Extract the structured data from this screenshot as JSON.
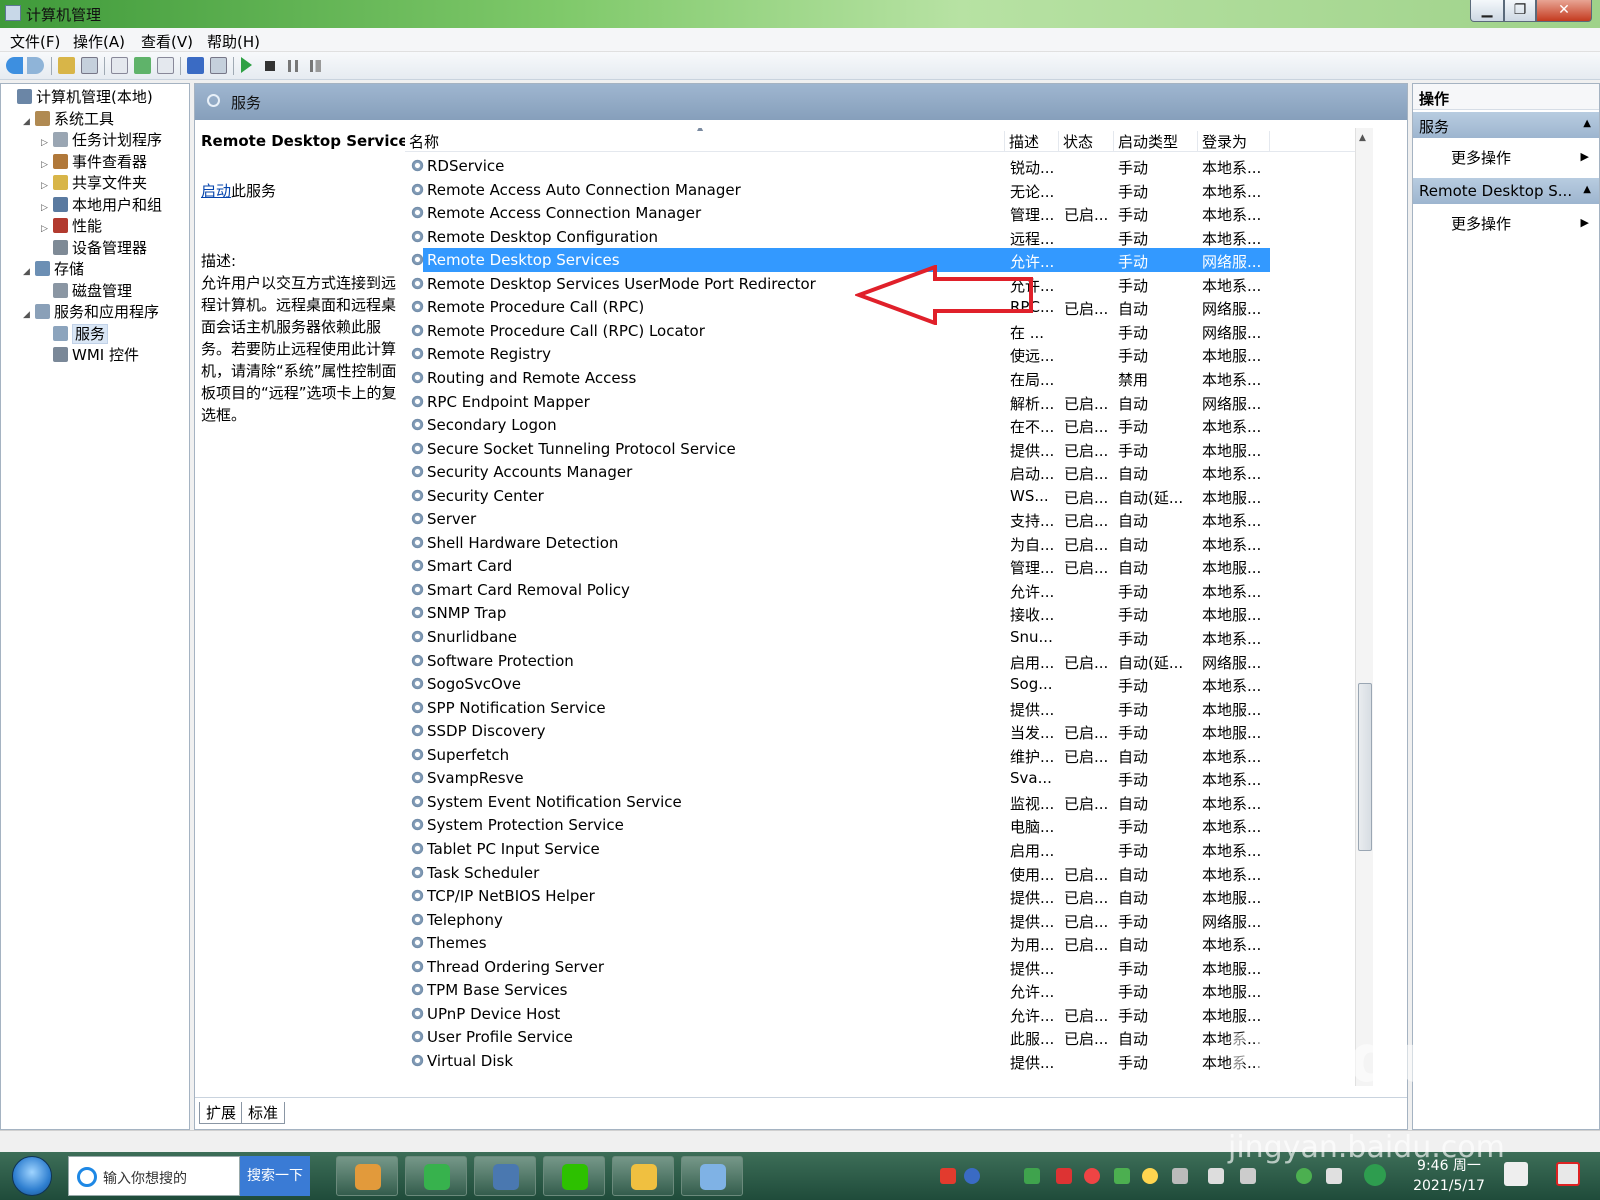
{
  "window": {
    "title": "计算机管理",
    "min_glyph": "▁",
    "max_glyph": "❐",
    "close_glyph": "✕"
  },
  "menu": [
    "文件(F)",
    "操作(A)",
    "查看(V)",
    "帮助(H)"
  ],
  "tree": [
    {
      "label": "计算机管理(本地)",
      "level": 0,
      "expander": "",
      "icon": "computer-management-icon",
      "color": "#6b86a6"
    },
    {
      "label": "系统工具",
      "level": 1,
      "expander": "◢",
      "icon": "tools-icon",
      "color": "#b08a52"
    },
    {
      "label": "任务计划程序",
      "level": 2,
      "expander": "▷",
      "icon": "clock-icon",
      "color": "#9aa6b3"
    },
    {
      "label": "事件查看器",
      "level": 2,
      "expander": "▷",
      "icon": "event-viewer-icon",
      "color": "#b0783a"
    },
    {
      "label": "共享文件夹",
      "level": 2,
      "expander": "▷",
      "icon": "shared-folder-icon",
      "color": "#d8b548"
    },
    {
      "label": "本地用户和组",
      "level": 2,
      "expander": "▷",
      "icon": "users-icon",
      "color": "#5a7aa0"
    },
    {
      "label": "性能",
      "level": 2,
      "expander": "▷",
      "icon": "performance-icon",
      "color": "#b23a2f"
    },
    {
      "label": "设备管理器",
      "level": 2,
      "expander": "",
      "icon": "device-manager-icon",
      "color": "#7e8a96"
    },
    {
      "label": "存储",
      "level": 1,
      "expander": "◢",
      "icon": "storage-icon",
      "color": "#6c8fb4"
    },
    {
      "label": "磁盘管理",
      "level": 2,
      "expander": "",
      "icon": "disk-icon",
      "color": "#8a96a3"
    },
    {
      "label": "服务和应用程序",
      "level": 1,
      "expander": "◢",
      "icon": "services-apps-icon",
      "color": "#8aa0b8"
    },
    {
      "label": "服务",
      "level": 2,
      "expander": "",
      "icon": "gear-icon",
      "color": "#8ca4bd",
      "selected": true
    },
    {
      "label": "WMI 控件",
      "level": 2,
      "expander": "",
      "icon": "wmi-icon",
      "color": "#7a8898"
    }
  ],
  "center": {
    "header": "服务",
    "detail": {
      "service_name": "Remote Desktop Services",
      "start_link": "启动",
      "start_suffix": "此服务",
      "desc_label": "描述:",
      "description": "允许用户以交互方式连接到远程计算机。远程桌面和远程桌面会话主机服务器依赖此服务。若要防止远程使用此计算机，请清除“系统”属性控制面板项目的“远程”选项卡上的复选框。"
    },
    "sort_glyph": "▲",
    "columns": [
      "名称",
      "描述",
      "状态",
      "启动类型",
      "登录为"
    ],
    "rows": [
      [
        "RDService",
        "锐动...",
        "",
        "手动",
        "本地系..."
      ],
      [
        "Remote Access Auto Connection Manager",
        "无论...",
        "",
        "手动",
        "本地系..."
      ],
      [
        "Remote Access Connection Manager",
        "管理...",
        "已启...",
        "手动",
        "本地系..."
      ],
      [
        "Remote Desktop Configuration",
        "远程...",
        "",
        "手动",
        "本地系..."
      ],
      [
        "Remote Desktop Services",
        "允许...",
        "",
        "手动",
        "网络服..."
      ],
      [
        "Remote Desktop Services UserMode Port Redirector",
        "允许...",
        "",
        "手动",
        "本地系..."
      ],
      [
        "Remote Procedure Call (RPC)",
        "RPC...",
        "已启...",
        "自动",
        "网络服..."
      ],
      [
        "Remote Procedure Call (RPC) Locator",
        "在 ...",
        "",
        "手动",
        "网络服..."
      ],
      [
        "Remote Registry",
        "使远...",
        "",
        "手动",
        "本地服..."
      ],
      [
        "Routing and Remote Access",
        "在局...",
        "",
        "禁用",
        "本地系..."
      ],
      [
        "RPC Endpoint Mapper",
        "解析...",
        "已启...",
        "自动",
        "网络服..."
      ],
      [
        "Secondary Logon",
        "在不...",
        "已启...",
        "手动",
        "本地系..."
      ],
      [
        "Secure Socket Tunneling Protocol Service",
        "提供...",
        "已启...",
        "手动",
        "本地服..."
      ],
      [
        "Security Accounts Manager",
        "启动...",
        "已启...",
        "自动",
        "本地系..."
      ],
      [
        "Security Center",
        "WS...",
        "已启...",
        "自动(延...",
        "本地服..."
      ],
      [
        "Server",
        "支持...",
        "已启...",
        "自动",
        "本地系..."
      ],
      [
        "Shell Hardware Detection",
        "为自...",
        "已启...",
        "自动",
        "本地系..."
      ],
      [
        "Smart Card",
        "管理...",
        "已启...",
        "自动",
        "本地服..."
      ],
      [
        "Smart Card Removal Policy",
        "允许...",
        "",
        "手动",
        "本地系..."
      ],
      [
        "SNMP Trap",
        "接收...",
        "",
        "手动",
        "本地服..."
      ],
      [
        "Snurlidbane",
        "Snu...",
        "",
        "手动",
        "本地系..."
      ],
      [
        "Software Protection",
        "启用...",
        "已启...",
        "自动(延...",
        "网络服..."
      ],
      [
        "SogoSvcOve",
        "Sog...",
        "",
        "手动",
        "本地系..."
      ],
      [
        "SPP Notification Service",
        "提供...",
        "",
        "手动",
        "本地服..."
      ],
      [
        "SSDP Discovery",
        "当发...",
        "已启...",
        "手动",
        "本地服..."
      ],
      [
        "Superfetch",
        "维护...",
        "已启...",
        "自动",
        "本地系..."
      ],
      [
        "SvampResve",
        "Sva...",
        "",
        "手动",
        "本地系..."
      ],
      [
        "System Event Notification Service",
        "监视...",
        "已启...",
        "自动",
        "本地系..."
      ],
      [
        "System Protection Service",
        "电脑...",
        "",
        "手动",
        "本地系..."
      ],
      [
        "Tablet PC Input Service",
        "启用...",
        "",
        "手动",
        "本地系..."
      ],
      [
        "Task Scheduler",
        "使用...",
        "已启...",
        "自动",
        "本地系..."
      ],
      [
        "TCP/IP NetBIOS Helper",
        "提供...",
        "已启...",
        "自动",
        "本地服..."
      ],
      [
        "Telephony",
        "提供...",
        "已启...",
        "手动",
        "网络服..."
      ],
      [
        "Themes",
        "为用...",
        "已启...",
        "自动",
        "本地系..."
      ],
      [
        "Thread Ordering Server",
        "提供...",
        "",
        "手动",
        "本地服..."
      ],
      [
        "TPM Base Services",
        "允许...",
        "",
        "手动",
        "本地服..."
      ],
      [
        "UPnP Device Host",
        "允许...",
        "已启...",
        "手动",
        "本地服..."
      ],
      [
        "User Profile Service",
        "此服...",
        "已启...",
        "自动",
        "本地系..."
      ],
      [
        "Virtual Disk",
        "提供...",
        "",
        "手动",
        "本地系..."
      ]
    ],
    "selected_row": "Remote Desktop Services",
    "tabs": [
      "扩展",
      "标准"
    ]
  },
  "actions": {
    "title": "操作",
    "sections": [
      {
        "title": "服务",
        "item": "更多操作"
      },
      {
        "title": "Remote Desktop S...",
        "item": "更多操作"
      }
    ],
    "collapse_glyph": "▲",
    "more_glyph": "▶"
  },
  "taskbar": {
    "search_placeholder": "输入你想搜的",
    "search_button": "搜索一下",
    "time": "9:46 周一",
    "date": "2021/5/17",
    "apps": [
      {
        "name": "paint-app",
        "color": "#e29a3b"
      },
      {
        "name": "browser-app",
        "color": "#37b24d"
      },
      {
        "name": "computer-management-app",
        "color": "#4a78b0"
      },
      {
        "name": "wechat-app",
        "color": "#2dc100"
      },
      {
        "name": "explorer-app",
        "color": "#f0c040"
      },
      {
        "name": "notepad-app",
        "color": "#7fb2e5"
      }
    ]
  },
  "watermark": {
    "brand": "Baidu经验",
    "url": "jingyan.baidu.com"
  },
  "colors": {
    "selection": "#3399ff",
    "arrow": "#e0202a",
    "title_bar": "#7fc96a"
  }
}
